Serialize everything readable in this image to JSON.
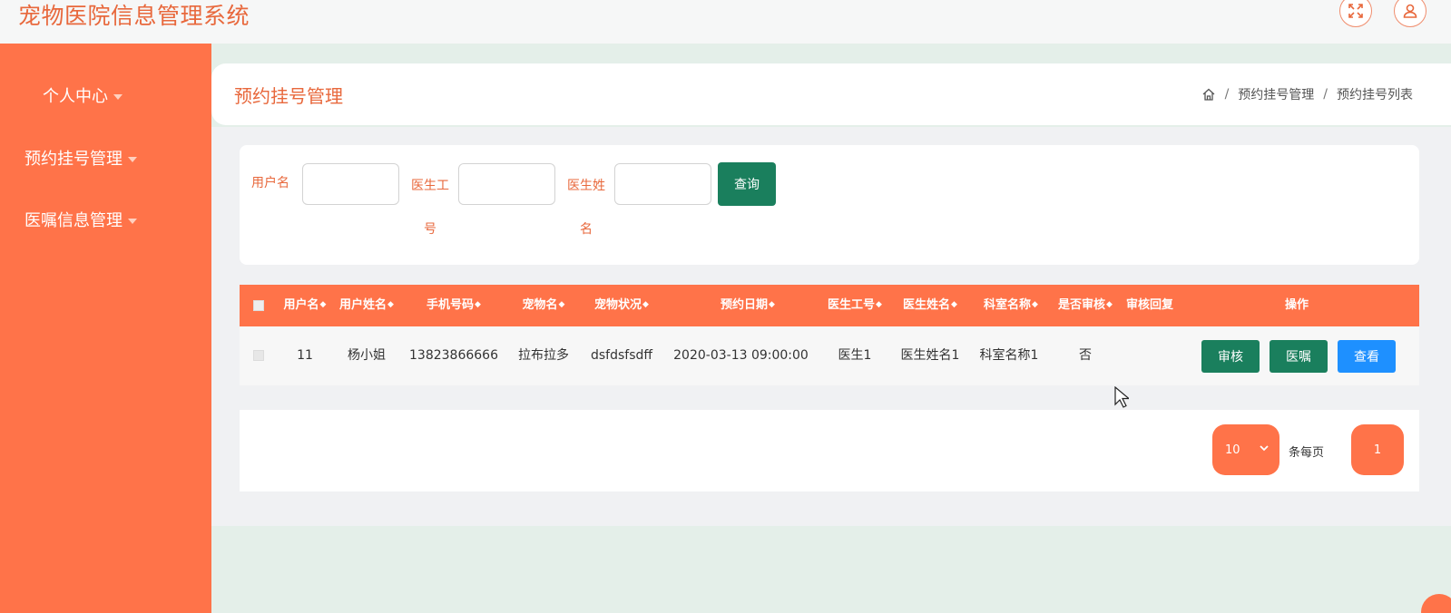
{
  "app": {
    "title": "宠物医院信息管理系统"
  },
  "header_icons": {
    "fullscreen": "expand-icon",
    "user": "user-icon"
  },
  "sidebar": {
    "items": [
      {
        "label": "个人中心"
      },
      {
        "label": "预约挂号管理"
      },
      {
        "label": "医嘱信息管理"
      }
    ]
  },
  "page": {
    "title": "预约挂号管理",
    "breadcrumb": [
      "预约挂号管理",
      "预约挂号列表"
    ],
    "breadcrumb_sep": "/"
  },
  "search": {
    "username_label": "用户名",
    "doctor_id_label": "医生工号",
    "doctor_name_label": "医生姓名",
    "username_value": "",
    "doctor_id_value": "",
    "doctor_name_value": "",
    "query_button": "查询"
  },
  "table": {
    "sort_glyph": "◆",
    "columns": [
      "用户名",
      "用户姓名",
      "手机号码",
      "宠物名",
      "宠物状况",
      "预约日期",
      "医生工号",
      "医生姓名",
      "科室名称",
      "是否审核",
      "审核回复",
      "操作"
    ],
    "rows": [
      {
        "username": "11",
        "name": "杨小姐",
        "phone": "13823866666",
        "pet": "拉布拉多",
        "pet_status": "dsfdsfsdff",
        "date": "2020-03-13 09:00:00",
        "doctor_id": "医生1",
        "doctor_name": "医生姓名1",
        "dept": "科室名称1",
        "reviewed": "否",
        "reply": "",
        "actions": [
          "审核",
          "医嘱",
          "查看"
        ]
      }
    ]
  },
  "pager": {
    "page_size": "10",
    "per_page_label": "条每页",
    "current_page": "1"
  },
  "colors": {
    "accent": "#ff7349",
    "title": "#e8683c",
    "green": "#1a7f5d",
    "blue": "#1e90ff"
  }
}
